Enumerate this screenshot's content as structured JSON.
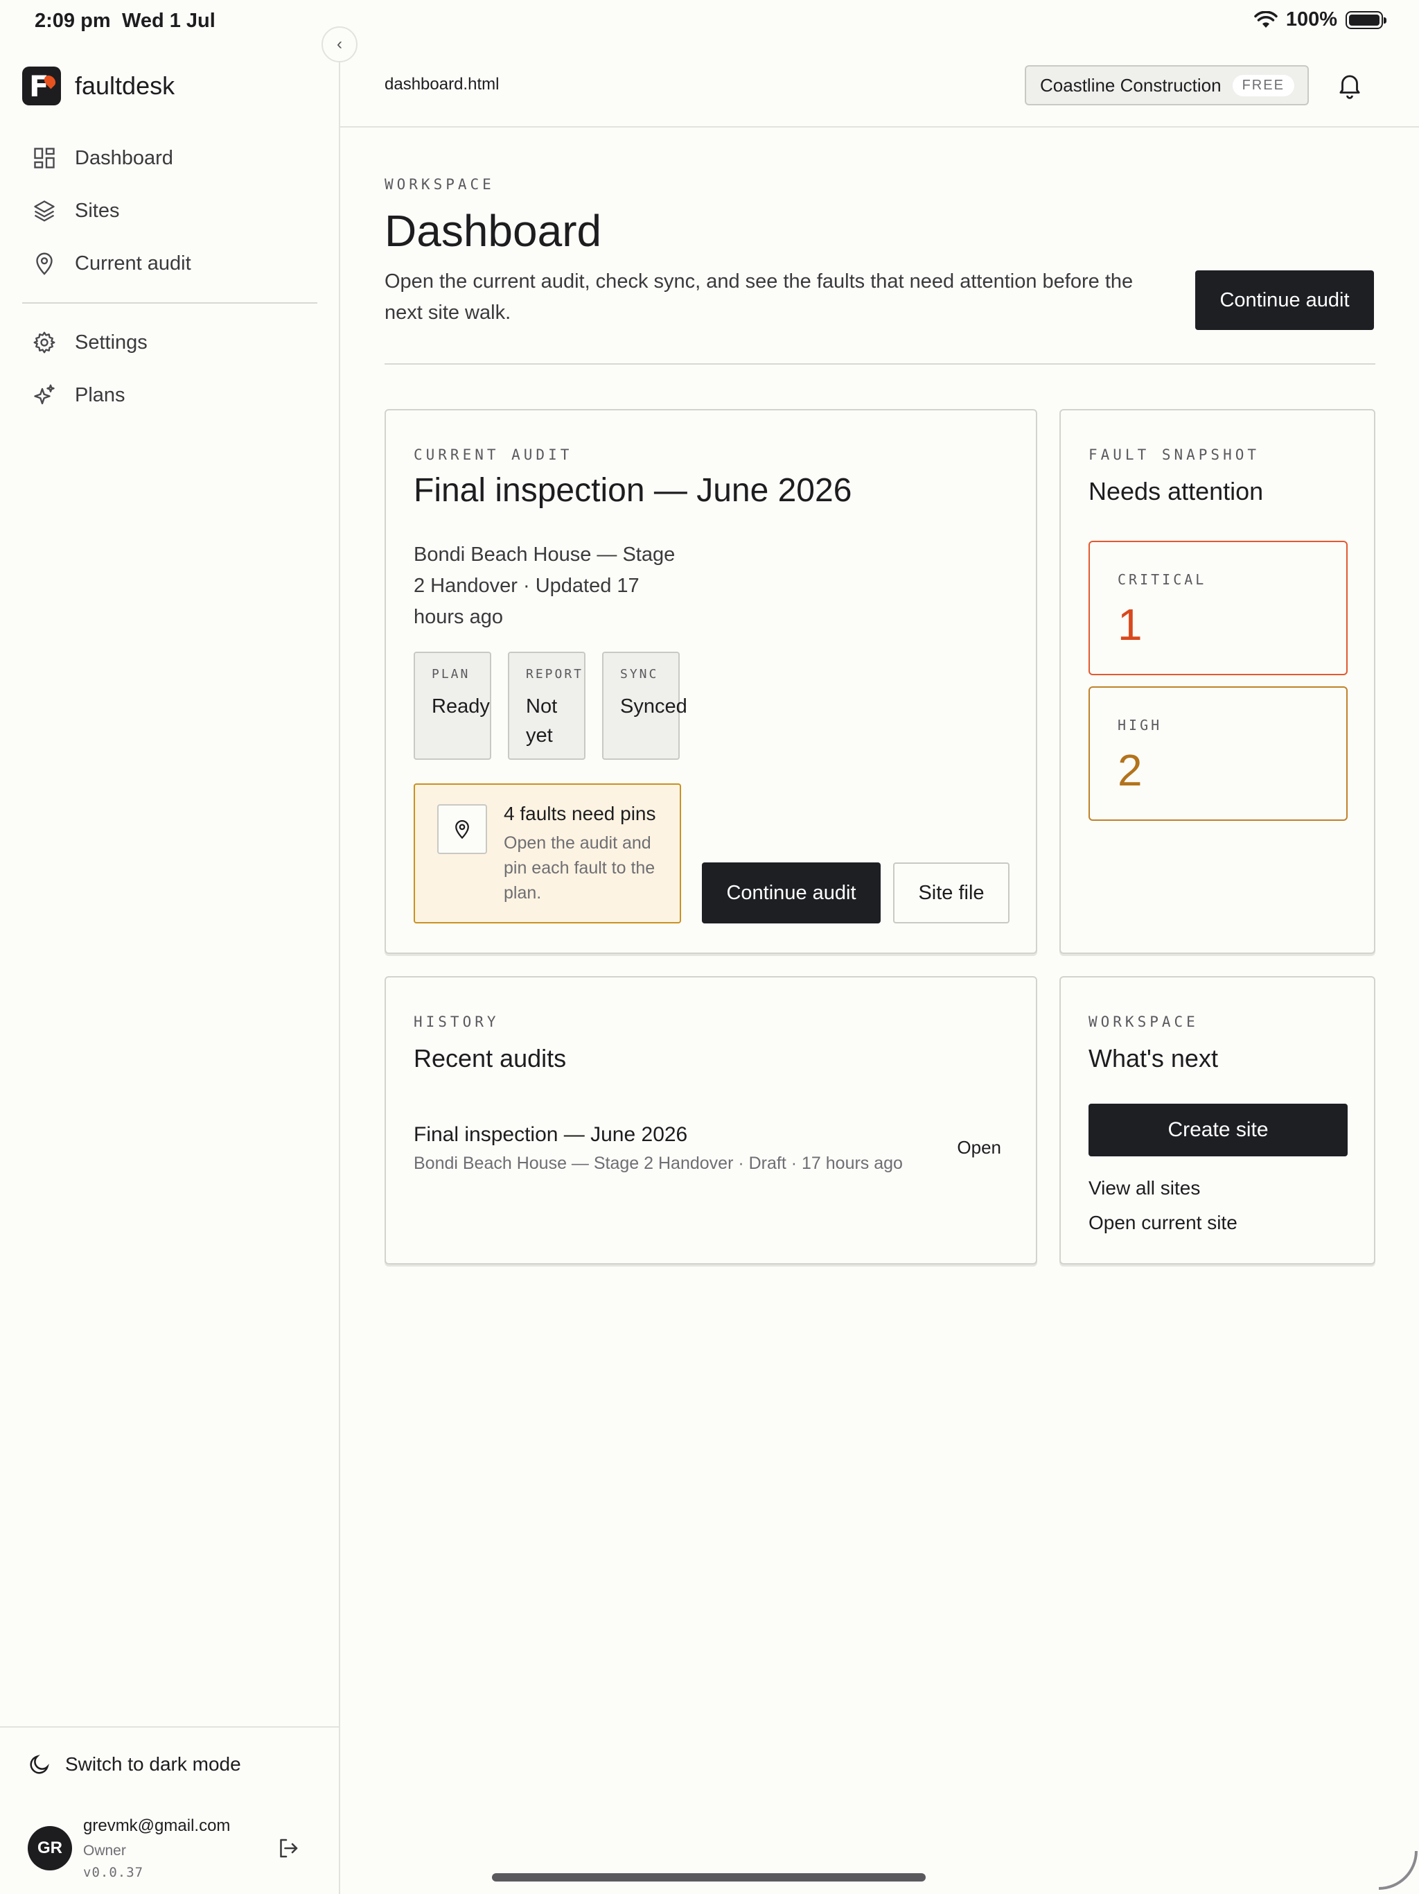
{
  "status_bar": {
    "time": "2:09 pm",
    "date": "Wed 1 Jul",
    "battery": "100%"
  },
  "brand": {
    "logo_letter": "F",
    "name": "faultdesk"
  },
  "nav": {
    "items": [
      {
        "label": "Dashboard",
        "icon": "dashboard-grid-icon"
      },
      {
        "label": "Sites",
        "icon": "layers-icon"
      },
      {
        "label": "Current audit",
        "icon": "map-pin-icon"
      },
      {
        "label": "Settings",
        "icon": "gear-icon"
      },
      {
        "label": "Plans",
        "icon": "sparkles-icon"
      }
    ]
  },
  "sidebar_bottom": {
    "dark_mode_label": "Switch to dark mode",
    "user": {
      "initials": "GR",
      "email": "grevmk@gmail.com",
      "role": "Owner",
      "version": "v0.0.37"
    }
  },
  "topbar": {
    "file": "dashboard.html",
    "org": "Coastline Construction",
    "plan_badge": "FREE"
  },
  "header": {
    "eyebrow": "WORKSPACE",
    "title": "Dashboard",
    "description": "Open the current audit, check sync, and see the faults that need attention before the next site walk.",
    "cta": "Continue audit"
  },
  "current_audit": {
    "eyebrow": "CURRENT AUDIT",
    "title": "Final inspection — June 2026",
    "subtitle": "Bondi Beach House — Stage 2 Handover · Updated 17 hours ago",
    "stats": [
      {
        "label": "PLAN",
        "value": "Ready"
      },
      {
        "label": "REPORT",
        "value": "Not yet"
      },
      {
        "label": "SYNC",
        "value": "Synced"
      }
    ],
    "alert": {
      "title": "4 faults need pins",
      "description": "Open the audit and pin each fault to the plan."
    },
    "primary_button": "Continue audit",
    "secondary_button": "Site file"
  },
  "fault_snapshot": {
    "eyebrow": "FAULT SNAPSHOT",
    "title": "Needs attention",
    "critical": {
      "label": "CRITICAL",
      "value": "1",
      "color": "#d9481d"
    },
    "high": {
      "label": "HIGH",
      "value": "2",
      "color": "#b3731b"
    }
  },
  "history": {
    "eyebrow": "HISTORY",
    "title": "Recent audits",
    "rows": [
      {
        "title": "Final inspection — June 2026",
        "meta": "Bondi Beach House — Stage 2 Handover · Draft · 17 hours ago",
        "action": "Open"
      }
    ]
  },
  "whats_next": {
    "eyebrow": "WORKSPACE",
    "title": "What's next",
    "primary_button": "Create site",
    "links": [
      "View all sites",
      "Open current site"
    ]
  }
}
